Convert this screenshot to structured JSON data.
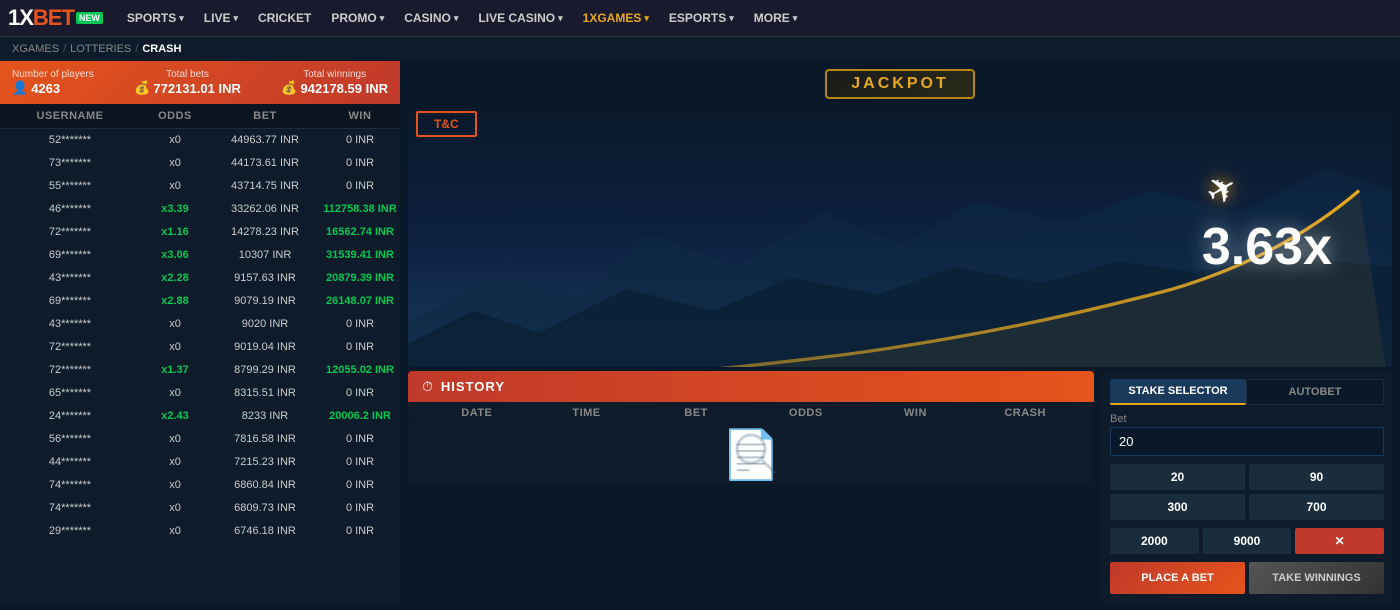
{
  "nav": {
    "logo": "1XBET",
    "logo_new": "NEW",
    "items": [
      {
        "label": "SPORTS",
        "arrow": true,
        "active": false
      },
      {
        "label": "LIVE",
        "arrow": true,
        "active": false
      },
      {
        "label": "CRICKET",
        "arrow": false,
        "active": false
      },
      {
        "label": "PROMO",
        "arrow": true,
        "active": false
      },
      {
        "label": "CASINO",
        "arrow": true,
        "active": false
      },
      {
        "label": "LIVE CASINO",
        "arrow": true,
        "active": false
      },
      {
        "label": "1XGAMES",
        "arrow": true,
        "active": true
      },
      {
        "label": "ESPORTS",
        "arrow": true,
        "active": false
      },
      {
        "label": "MORE",
        "arrow": true,
        "active": false
      }
    ]
  },
  "breadcrumb": {
    "items": [
      "XGAMES",
      "LOTTERIES",
      "CRASH"
    ]
  },
  "stats": {
    "players_label": "Number of players",
    "players_value": "4263",
    "players_icon": "👤",
    "bets_label": "Total bets",
    "bets_value": "772131.01 INR",
    "bets_icon": "💰",
    "winnings_label": "Total winnings",
    "winnings_value": "942178.59 INR",
    "winnings_icon": "💰"
  },
  "table": {
    "headers": [
      "USERNAME",
      "ODDS",
      "BET",
      "WIN"
    ],
    "rows": [
      {
        "username": "52*******",
        "odds": "x0",
        "bet": "44963.77 INR",
        "win": "0 INR",
        "win_type": "normal",
        "odds_type": "normal"
      },
      {
        "username": "73*******",
        "odds": "x0",
        "bet": "44173.61 INR",
        "win": "0 INR",
        "win_type": "normal",
        "odds_type": "normal"
      },
      {
        "username": "55*******",
        "odds": "x0",
        "bet": "43714.75 INR",
        "win": "0 INR",
        "win_type": "normal",
        "odds_type": "normal"
      },
      {
        "username": "46*******",
        "odds": "x3.39",
        "bet": "33262.06 INR",
        "win": "112758.38 INR",
        "win_type": "green",
        "odds_type": "green"
      },
      {
        "username": "72*******",
        "odds": "x1.16",
        "bet": "14278.23 INR",
        "win": "16562.74 INR",
        "win_type": "green",
        "odds_type": "green"
      },
      {
        "username": "69*******",
        "odds": "x3.06",
        "bet": "10307 INR",
        "win": "31539.41 INR",
        "win_type": "green",
        "odds_type": "green"
      },
      {
        "username": "43*******",
        "odds": "x2.28",
        "bet": "9157.63 INR",
        "win": "20879.39 INR",
        "win_type": "green",
        "odds_type": "green"
      },
      {
        "username": "69*******",
        "odds": "x2.88",
        "bet": "9079.19 INR",
        "win": "26148.07 INR",
        "win_type": "green",
        "odds_type": "green"
      },
      {
        "username": "43*******",
        "odds": "x0",
        "bet": "9020 INR",
        "win": "0 INR",
        "win_type": "normal",
        "odds_type": "normal"
      },
      {
        "username": "72*******",
        "odds": "x0",
        "bet": "9019.04 INR",
        "win": "0 INR",
        "win_type": "normal",
        "odds_type": "normal"
      },
      {
        "username": "72*******",
        "odds": "x1.37",
        "bet": "8799.29 INR",
        "win": "12055.02 INR",
        "win_type": "green",
        "odds_type": "green"
      },
      {
        "username": "65*******",
        "odds": "x0",
        "bet": "8315.51 INR",
        "win": "0 INR",
        "win_type": "normal",
        "odds_type": "normal"
      },
      {
        "username": "24*******",
        "odds": "x2.43",
        "bet": "8233 INR",
        "win": "20006.2 INR",
        "win_type": "green",
        "odds_type": "green"
      },
      {
        "username": "56*******",
        "odds": "x0",
        "bet": "7816.58 INR",
        "win": "0 INR",
        "win_type": "normal",
        "odds_type": "normal"
      },
      {
        "username": "44*******",
        "odds": "x0",
        "bet": "7215.23 INR",
        "win": "0 INR",
        "win_type": "normal",
        "odds_type": "normal"
      },
      {
        "username": "74*******",
        "odds": "x0",
        "bet": "6860.84 INR",
        "win": "0 INR",
        "win_type": "normal",
        "odds_type": "normal"
      },
      {
        "username": "74*******",
        "odds": "x0",
        "bet": "6809.73 INR",
        "win": "0 INR",
        "win_type": "normal",
        "odds_type": "normal"
      },
      {
        "username": "29*******",
        "odds": "x0",
        "bet": "6746.18 INR",
        "win": "0 INR",
        "win_type": "normal",
        "odds_type": "normal"
      }
    ]
  },
  "game": {
    "jackpot_label": "JACKPOT",
    "tc_label": "T&C",
    "multiplier": "3.63x",
    "plane": "✈️"
  },
  "history": {
    "title": "HISTORY",
    "icon": "🕐",
    "columns": [
      "DATE",
      "TIME",
      "BET",
      "ODDS",
      "WIN",
      "CRASH"
    ]
  },
  "stake": {
    "tab_selector": "STAKE SELECTOR",
    "tab_autobet": "AUTOBET",
    "bet_label": "Bet",
    "bet_value": "20",
    "quick_bets_row1": [
      "20",
      "90",
      "300",
      "700"
    ],
    "quick_bets_row2": [
      "2000",
      "9000"
    ],
    "clear_label": "✕",
    "place_bet_label": "PLACE A BET",
    "take_winnings_label": "TAKE WINNINGS"
  }
}
